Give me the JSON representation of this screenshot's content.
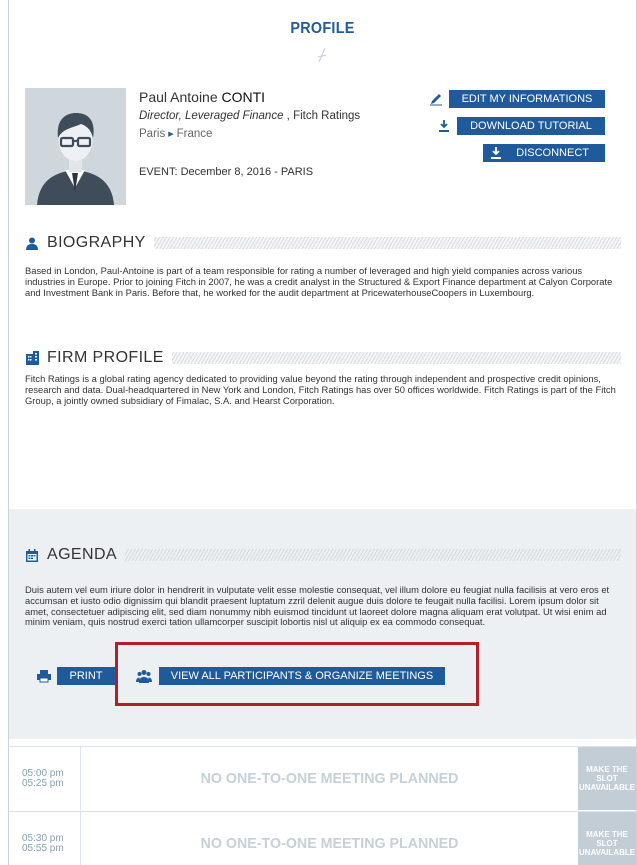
{
  "page": {
    "title": "PROFILE"
  },
  "profile": {
    "first_names": "Paul Antoine",
    "last_name": "CONTI",
    "position": "Director, Leveraged Finance",
    "company_sep": " , ",
    "company": "Fitch Ratings",
    "city": "Paris",
    "country": "France",
    "event": "EVENT: December 8, 2016 - PARIS"
  },
  "actions": {
    "edit": "EDIT MY INFORMATIONS",
    "download": "DOWNLOAD TUTORIAL",
    "disconnect": "DISCONNECT"
  },
  "biography": {
    "heading": "BIOGRAPHY",
    "text": "Based in London, Paul-Antoine is part of a team responsible for rating a number of leveraged and high yield companies across various industries in Europe. Prior to joining Fitch in 2007, he was a credit analyst in the Structured & Export Finance department at Calyon Corporate and Investment Bank in Paris. Before that, he worked for the audit department at PricewaterhouseCoopers in Luxembourg."
  },
  "firm": {
    "heading": "FIRM PROFILE",
    "text": "Fitch Ratings is a global rating agency dedicated to providing value beyond the rating through independent and prospective credit opinions, research and data. Dual-headquartered in New York and London, Fitch Ratings has over 50 offices worldwide. Fitch Ratings is part of the Fitch Group, a jointly owned subsidiary of Fimalac, S.A. and Hearst Corporation."
  },
  "agenda": {
    "heading": "AGENDA",
    "text": "Duis autem vel eum iriure dolor in hendrerit in vulputate velit esse molestie consequat, vel illum dolore eu feugiat nulla facilisis at vero eros et accumsan et iusto odio dignissim qui blandit praesent luptatum zzril delenit augue duis dolore te feugait nulla facilisi. Lorem ipsum dolor sit amet, consectetuer adipiscing elit, sed diam nonummy nibh euismod tincidunt ut laoreet dolore magna aliquam erat volutpat. Ut wisi enim ad minim veniam, quis nostrud exerci tation ullamcorper suscipit lobortis nisl ut aliquip ex ea commodo consequat.",
    "print": "PRINT",
    "view_all": "VIEW ALL PARTICIPANTS & ORGANIZE MEETINGS"
  },
  "slots": [
    {
      "start": "05:00 pm",
      "end": "05:25 pm",
      "status": "NO ONE-TO-ONE MEETING PLANNED",
      "action_line1": "MAKE THE SLOT",
      "action_line2": "UNAVAILABLE"
    },
    {
      "start": "05:30 pm",
      "end": "05:55 pm",
      "status": "NO ONE-TO-ONE MEETING PLANNED",
      "action_line1": "MAKE THE SLOT",
      "action_line2": "UNAVAILABLE"
    }
  ],
  "colors": {
    "accent": "#1f5b9a",
    "highlight": "#b0202b",
    "agenda_bg": "#ecf0f3"
  }
}
